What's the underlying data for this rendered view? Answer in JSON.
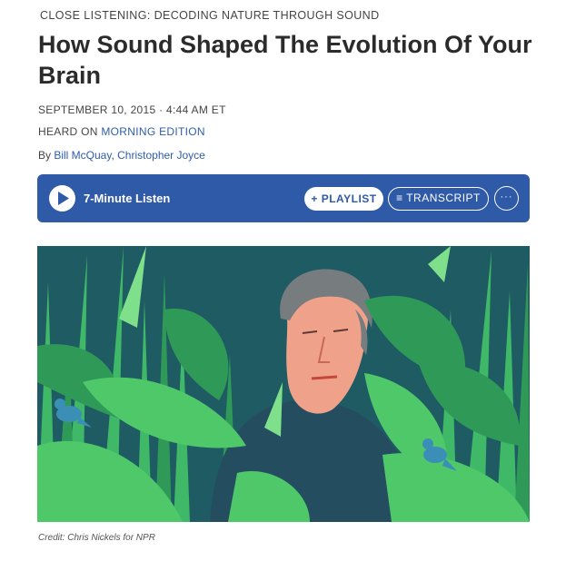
{
  "article": {
    "slug": "CLOSE LISTENING: DECODING NATURE THROUGH SOUND",
    "headline": "How Sound Shaped The Evolution Of Your Brain",
    "date": "SEPTEMBER 10, 2015 · 4:44 AM ET",
    "heard_on_prefix": "HEARD ON ",
    "heard_on_program": "MORNING EDITION",
    "byline_prefix": "By ",
    "authors": [
      "Bill McQuay",
      "Christopher Joyce"
    ],
    "author_separator": ", "
  },
  "player": {
    "listen_label": "7-Minute Listen",
    "playlist_label": "+ PLAYLIST",
    "transcript_label": "≡ TRANSCRIPT",
    "more_label": "···",
    "icons": [
      "play-icon",
      "more-icon"
    ]
  },
  "image": {
    "credit": "Credit: Chris Nickels for NPR"
  },
  "colors": {
    "player_bg": "#2f5aa8",
    "link": "#2e5ea8",
    "illustration_bg": "#1f5b63",
    "foliage_light": "#4fc86a",
    "foliage_dark": "#2f9a58",
    "face": "#f0a189",
    "hair": "#777c7f",
    "shirt": "#244e5f",
    "bird": "#3b8fb6"
  }
}
